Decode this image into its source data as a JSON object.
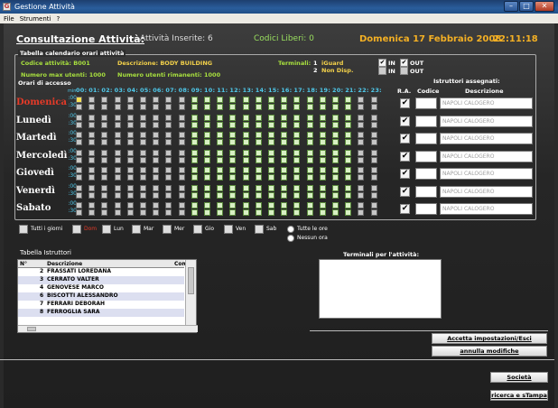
{
  "window": {
    "title": "Gestione Attività",
    "icon_letter": "G"
  },
  "menu": [
    "File",
    "Strumenti",
    "?"
  ],
  "header": {
    "title": "Consultazione Attività:",
    "inserite_label": "Attività Inserite:",
    "inserite_value": "6",
    "codici_liberi": "Codici Liberi: 0",
    "date": "Domenica 17 Febbraio 2008",
    "time": "22:11:18"
  },
  "calendar": {
    "legend": "Tabella calendario orari attività",
    "codice": "Codice attività: B001",
    "descrizione": "Descrizione: BODY BUILDING",
    "terminali_label": "Terminali:",
    "term1_num": "1",
    "term1_name": "iGuard",
    "term2_num": "2",
    "term2_name": "Non Disp.",
    "max_utenti": "Numero max utenti: 1000",
    "rimanenti": "Numero utenti rimanenti: 1000",
    "in_label": "IN",
    "out_label": "OUT",
    "in2_label": "IN",
    "out2_label": "OUT",
    "orari_label": "Orari di accesso",
    "istruttori_label": "Istruttori assegnati:",
    "col_ra": "R.A.",
    "col_codice": "Codice",
    "col_descrizione": "Descrizione",
    "min_label": "min",
    "hours": [
      "00:",
      "01:",
      "02:",
      "03:",
      "04:",
      "05:",
      "06:",
      "07:",
      "08:",
      "09:",
      "10:",
      "11:",
      "12:",
      "13:",
      "14:",
      "15:",
      "16:",
      "17:",
      "18:",
      "19:",
      "20:",
      "21:",
      "22:",
      "23:"
    ],
    "minutes": [
      ":00",
      ":30"
    ],
    "days": [
      "Domenica",
      "Lunedì",
      "Martedì",
      "Mercoledì",
      "Giovedì",
      "Venerdì",
      "Sabato"
    ],
    "active_hours_start": 9,
    "active_hours_end": 22,
    "instructor": [
      "NAPOLI CALOGERO",
      "NAPOLI CALOGERO",
      "NAPOLI CALOGERO",
      "NAPOLI CALOGERO",
      "NAPOLI CALOGERO",
      "NAPOLI CALOGERO",
      "NAPOLI CALOGERO"
    ],
    "colors": {
      "accent": "#4fc8ea",
      "active_cell": "#d8f0c4",
      "inactive_cell": "#c6c6c6",
      "sunday": "#e53a28",
      "date": "#f4b024"
    }
  },
  "day_filters": {
    "tutti": "Tutti i giorni",
    "dom": "Dom",
    "lun": "Lun",
    "mar": "Mar",
    "mer": "Mer",
    "gio": "Gio",
    "ven": "Ven",
    "sab": "Sab",
    "tutte_ore": "Tutte le ore",
    "nessuna_ora": "Nessun ora"
  },
  "istruttori": {
    "label": "Tabella Istruttori",
    "columns": {
      "n": "N°",
      "descrizione": "Descrizione",
      "com": "Com"
    },
    "rows": [
      {
        "n": "2",
        "d": "FRASSATI LOREDANA"
      },
      {
        "n": "3",
        "d": "CERRATO VALTER"
      },
      {
        "n": "4",
        "d": "GENOVESE MARCO"
      },
      {
        "n": "6",
        "d": "BISCOTTI ALESSANDRO"
      },
      {
        "n": "7",
        "d": "FERRARI DEBORAH"
      },
      {
        "n": "8",
        "d": "FERROGLIA SARA"
      }
    ]
  },
  "terminali": {
    "label": "Terminali per l'attività:"
  },
  "buttons": {
    "accetta": "Accetta impostazioni/Esci",
    "annulla": "annulla modifiche",
    "societa": "Società",
    "ricerca": "ricerca e sTampa"
  }
}
